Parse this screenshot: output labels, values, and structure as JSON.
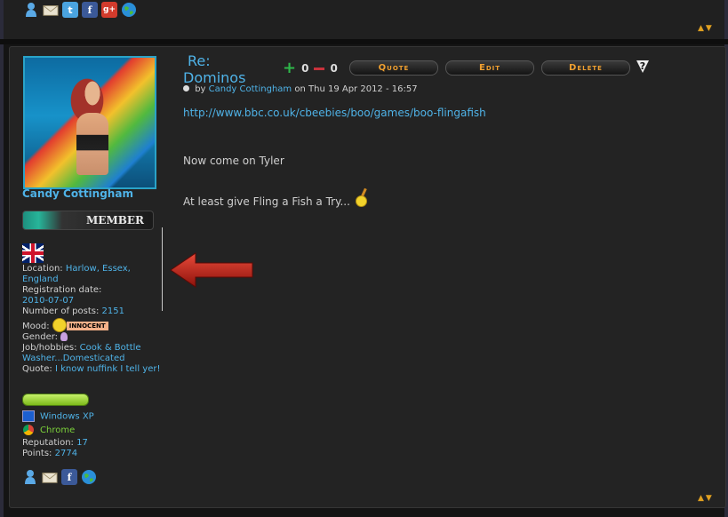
{
  "post": {
    "title_line1": "Re:",
    "title_line2": "Dominos",
    "votes_up": "0",
    "votes_down": "0",
    "buttons": {
      "quote": "Quote",
      "edit": "Edit",
      "delete": "Delete"
    },
    "help_label": "?",
    "meta": {
      "by_label": "by",
      "author": "Candy Cottingham",
      "on_label": "on",
      "date": "Thu 19 Apr 2012 - 16:57"
    },
    "body": {
      "link": "http://www.bbc.co.uk/cbeebies/boo/games/boo-flingafish",
      "line2": "Now come on Tyler",
      "line3": "At least give Fling a Fish a Try..."
    }
  },
  "profile": {
    "username": "Candy Cottingham",
    "rank": "MEMBER",
    "location_label": "Location:",
    "location": "Harlow, Essex, England",
    "registration_label": "Registration date:",
    "registration_date": "2010-07-07",
    "posts_label": "Number of posts:",
    "posts": "2151",
    "mood_label": "Mood:",
    "mood_text": "INNOCENT",
    "gender_label": "Gender:",
    "job_label": "Job/hobbies:",
    "job": "Cook & Bottle Washer...Domesticated",
    "quote_label": "Quote:",
    "quote": "I know nuffink I tell yer!",
    "os": "Windows XP",
    "browser": "Chrome",
    "reputation_label": "Reputation:",
    "reputation": "17",
    "points_label": "Points:",
    "points": "2774"
  },
  "icons": {
    "twitter": "t",
    "facebook": "f",
    "gplus": "g+",
    "updown": "▲▼"
  }
}
